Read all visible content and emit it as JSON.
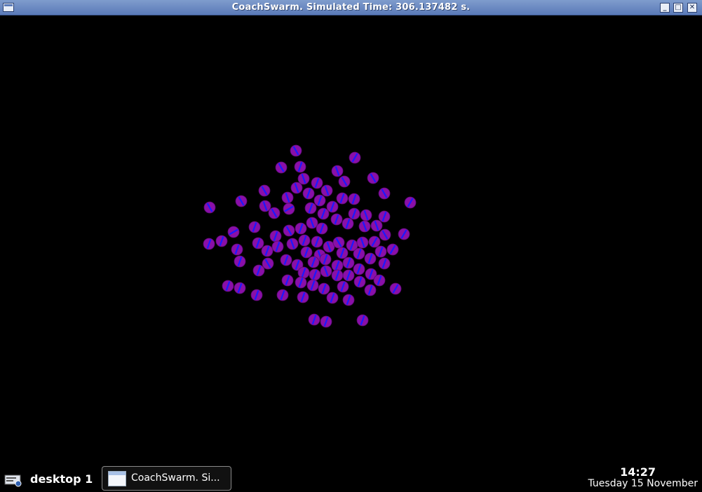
{
  "window": {
    "title": "CoachSwarm. Simulated Time: 306.137482 s.",
    "menu_icon": "window-menu-icon",
    "buttons": {
      "minimize": "_",
      "maximize": "□",
      "close": "✕"
    }
  },
  "simulation": {
    "agent_fill": "#8a0fa8",
    "agent_heading_color": "#1a1aff",
    "agents": [
      [
        422,
        215,
        -30
      ],
      [
        506,
        225,
        30
      ],
      [
        401,
        239,
        -30
      ],
      [
        428,
        238,
        20
      ],
      [
        481,
        244,
        -20
      ],
      [
        532,
        254,
        -30
      ],
      [
        491,
        259,
        -30
      ],
      [
        433,
        255,
        -20
      ],
      [
        452,
        261,
        20
      ],
      [
        466,
        272,
        -20
      ],
      [
        423,
        268,
        -20
      ],
      [
        377,
        272,
        -30
      ],
      [
        548,
        276,
        -30
      ],
      [
        410,
        282,
        -20
      ],
      [
        440,
        276,
        20
      ],
      [
        344,
        287,
        -30
      ],
      [
        585,
        289,
        30
      ],
      [
        299,
        296,
        -30
      ],
      [
        378,
        294,
        -20
      ],
      [
        412,
        298,
        60
      ],
      [
        443,
        297,
        20
      ],
      [
        456,
        286,
        20
      ],
      [
        474,
        295,
        20
      ],
      [
        488,
        283,
        20
      ],
      [
        505,
        284,
        20
      ],
      [
        391,
        304,
        -30
      ],
      [
        461,
        305,
        20
      ],
      [
        505,
        305,
        20
      ],
      [
        522,
        307,
        -20
      ],
      [
        548,
        309,
        20
      ],
      [
        363,
        324,
        20
      ],
      [
        333,
        331,
        60
      ],
      [
        412,
        329,
        -30
      ],
      [
        429,
        326,
        20
      ],
      [
        445,
        318,
        -20
      ],
      [
        459,
        326,
        20
      ],
      [
        480,
        313,
        20
      ],
      [
        496,
        319,
        20
      ],
      [
        520,
        323,
        -20
      ],
      [
        537,
        322,
        -20
      ],
      [
        576,
        334,
        30
      ],
      [
        316,
        344,
        20
      ],
      [
        298,
        348,
        20
      ],
      [
        368,
        347,
        20
      ],
      [
        393,
        337,
        20
      ],
      [
        417,
        348,
        -20
      ],
      [
        434,
        343,
        20
      ],
      [
        452,
        345,
        20
      ],
      [
        469,
        352,
        -20
      ],
      [
        483,
        346,
        -30
      ],
      [
        502,
        350,
        20
      ],
      [
        517,
        346,
        -20
      ],
      [
        534,
        345,
        30
      ],
      [
        549,
        335,
        -30
      ],
      [
        338,
        356,
        20
      ],
      [
        381,
        358,
        20
      ],
      [
        396,
        352,
        20
      ],
      [
        437,
        360,
        20
      ],
      [
        456,
        364,
        -20
      ],
      [
        488,
        361,
        20
      ],
      [
        512,
        362,
        20
      ],
      [
        528,
        369,
        20
      ],
      [
        543,
        359,
        20
      ],
      [
        560,
        356,
        30
      ],
      [
        342,
        373,
        20
      ],
      [
        382,
        376,
        -30
      ],
      [
        408,
        371,
        20
      ],
      [
        424,
        378,
        20
      ],
      [
        447,
        374,
        20
      ],
      [
        464,
        370,
        20
      ],
      [
        481,
        379,
        20
      ],
      [
        497,
        375,
        20
      ],
      [
        548,
        376,
        20
      ],
      [
        369,
        386,
        20
      ],
      [
        433,
        389,
        20
      ],
      [
        449,
        392,
        20
      ],
      [
        465,
        387,
        -20
      ],
      [
        481,
        393,
        20
      ],
      [
        497,
        393,
        20
      ],
      [
        512,
        384,
        20
      ],
      [
        529,
        391,
        20
      ],
      [
        410,
        400,
        20
      ],
      [
        429,
        403,
        20
      ],
      [
        446,
        407,
        20
      ],
      [
        462,
        412,
        20
      ],
      [
        489,
        409,
        20
      ],
      [
        513,
        402,
        20
      ],
      [
        541,
        400,
        20
      ],
      [
        325,
        408,
        20
      ],
      [
        342,
        411,
        20
      ],
      [
        366,
        421,
        20
      ],
      [
        403,
        421,
        20
      ],
      [
        432,
        424,
        20
      ],
      [
        474,
        425,
        20
      ],
      [
        497,
        428,
        20
      ],
      [
        528,
        414,
        20
      ],
      [
        564,
        412,
        30
      ],
      [
        448,
        456,
        20
      ],
      [
        465,
        459,
        20
      ],
      [
        517,
        457,
        20
      ]
    ]
  },
  "taskbar": {
    "menu_icon": "start-menu-icon",
    "desktop": "desktop 1",
    "task": {
      "label": "CoachSwarm. Si...",
      "icon": "window-app-icon"
    },
    "clock": {
      "time": "14:27",
      "date": "Tuesday 15 November"
    }
  },
  "colors": {
    "titlebar": "#6a88c2",
    "background": "#000000",
    "text": "#ffffff"
  }
}
